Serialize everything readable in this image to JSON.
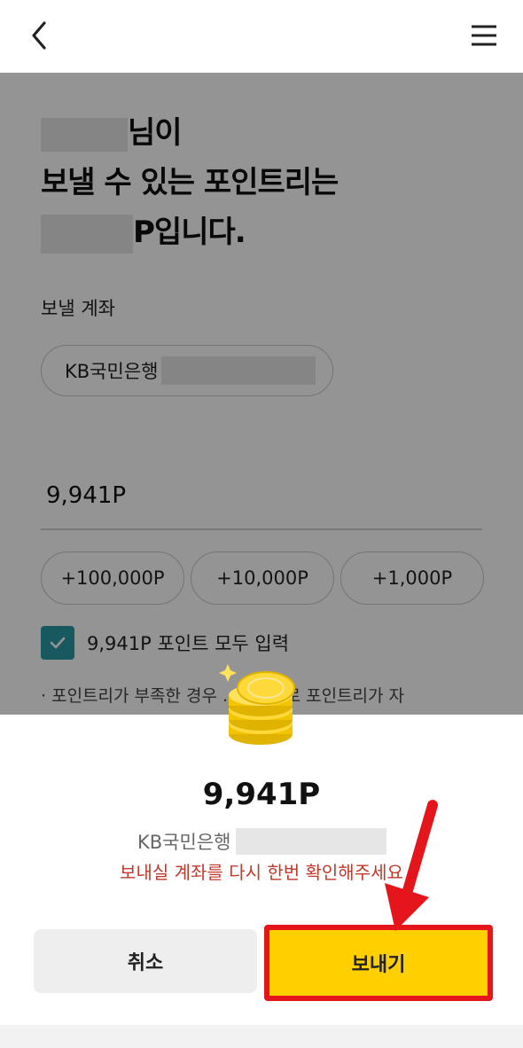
{
  "header": {
    "back_icon": "chevron-left-icon",
    "menu_icon": "hamburger-menu-icon"
  },
  "main": {
    "heading_line1_suffix": "님이",
    "heading_line2": "보낼 수 있는 포인트리는",
    "heading_line3_suffix": "P입니다.",
    "account_section_label": "보낼 계좌",
    "account_bank": "KB국민은행",
    "amount_value": "9,941P",
    "quick_buttons": [
      "+100,000P",
      "+10,000P",
      "+1,000P"
    ],
    "all_input_checkbox_label": "9,941P 포인트 모두 입력",
    "all_input_checked": true,
    "notice_text": "포인트리가 부족한 경우 ... P단위로 포인트리가 자"
  },
  "sheet": {
    "amount": "9,941P",
    "account_bank": "KB국민은행",
    "warning": "보내실 계좌를 다시 한번 확인해주세요",
    "cancel_label": "취소",
    "send_label": "보내기",
    "accent_color": "#ffcf00",
    "warning_color": "#c0392b",
    "highlight_color": "#e5161b"
  }
}
